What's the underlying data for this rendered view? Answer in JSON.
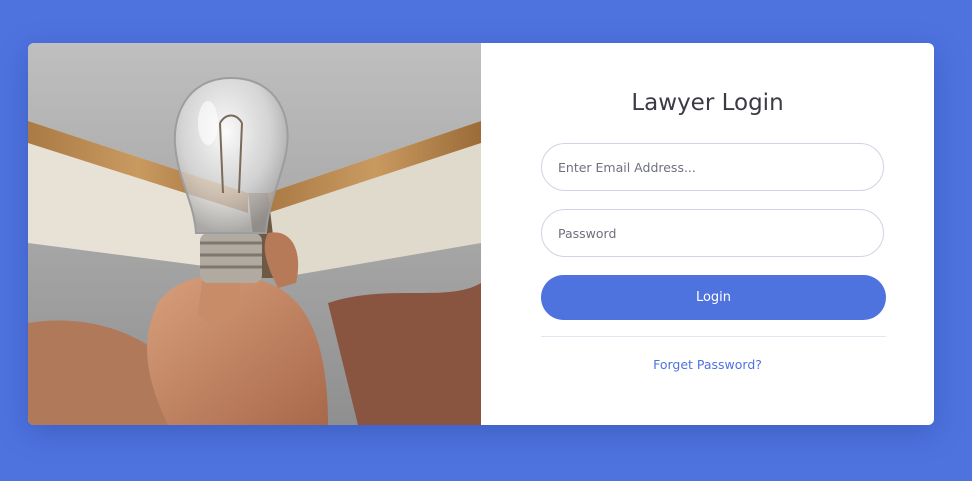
{
  "login": {
    "title": "Lawyer Login",
    "email_placeholder": "Enter Email Address...",
    "password_placeholder": "Password",
    "login_label": "Login",
    "forgot_label": "Forget Password?"
  },
  "colors": {
    "background": "#4e73df",
    "button": "#4e73df",
    "link": "#4e73df",
    "title": "#3a3b45"
  },
  "image": {
    "icon": "lightbulb-book-photo"
  }
}
